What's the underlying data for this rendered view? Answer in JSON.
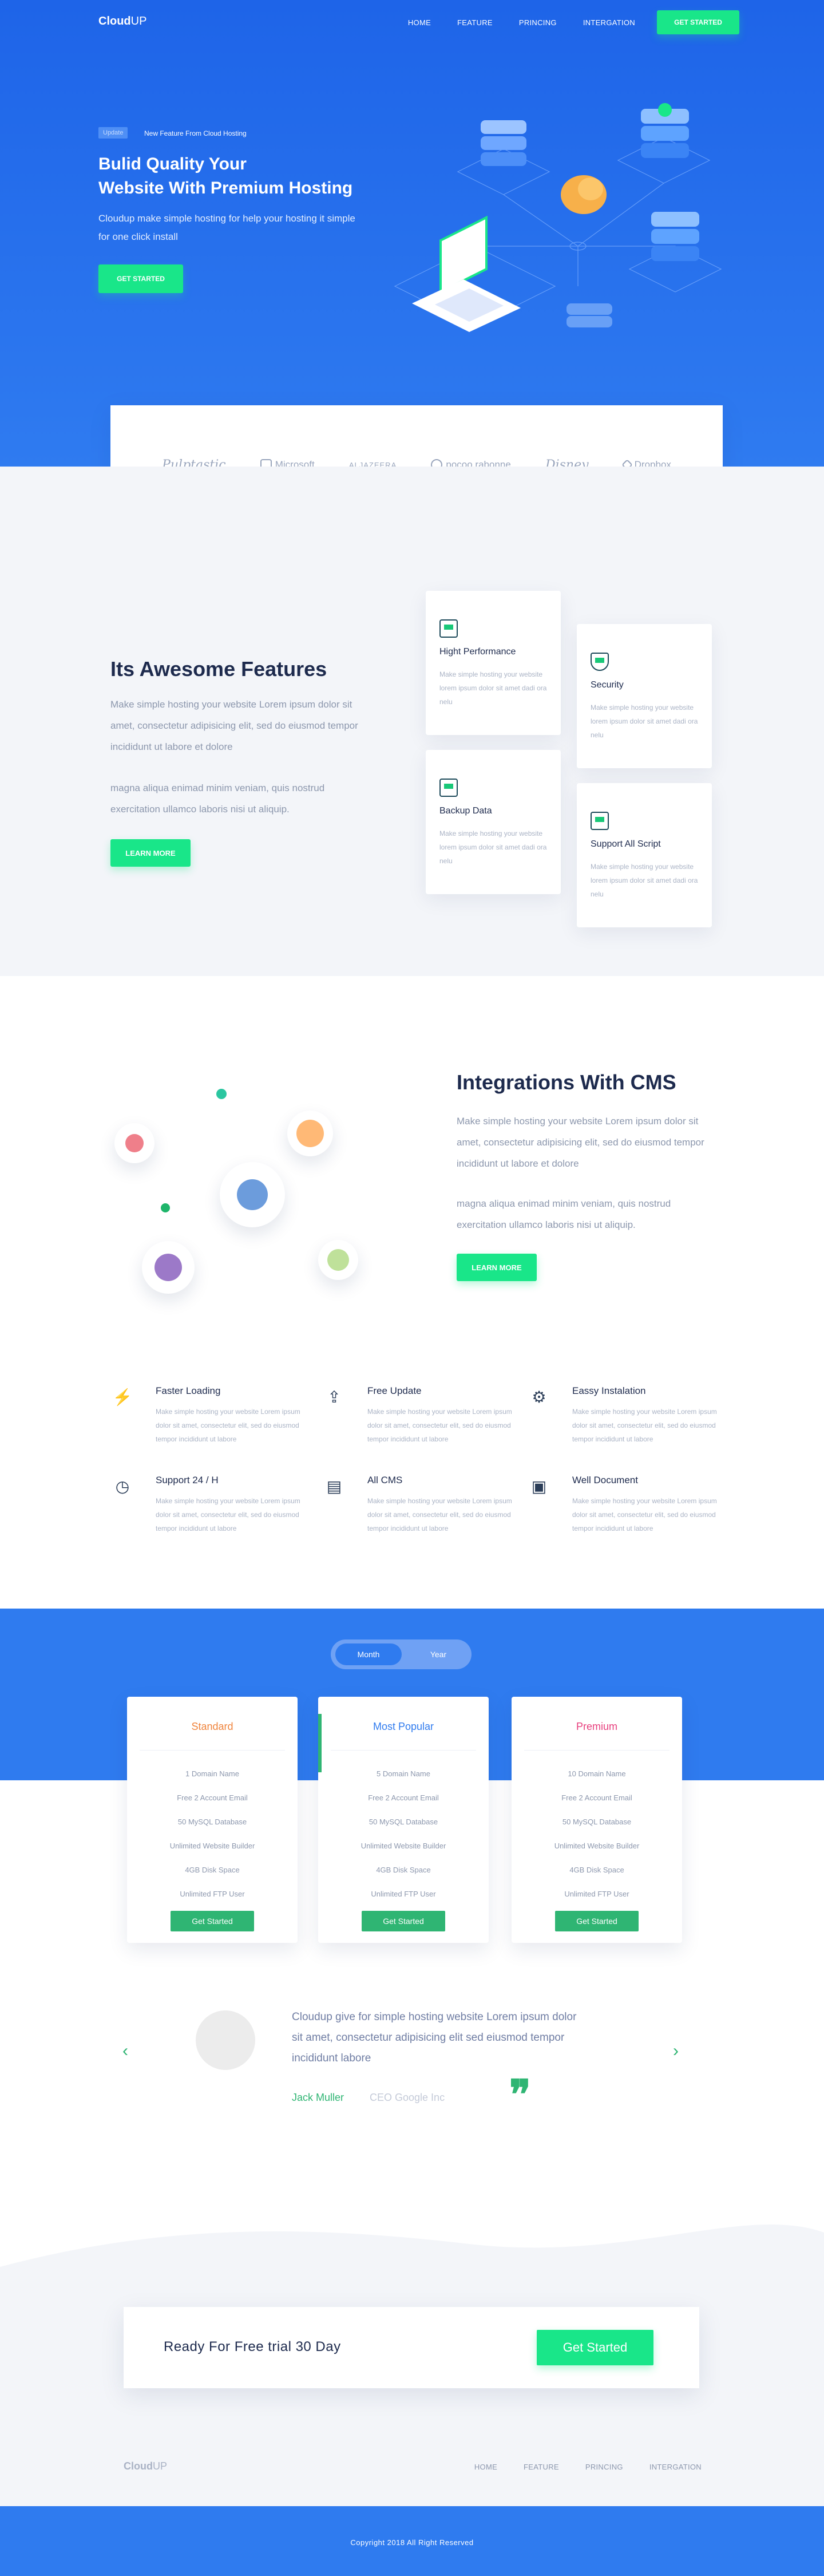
{
  "header": {
    "logo_main": "Cloud",
    "logo_accent": "UP",
    "nav": [
      "HOME",
      "FEATURE",
      "PRINCING",
      "INTERGATION"
    ],
    "cta": "GET STARTED"
  },
  "hero": {
    "badge": "Update",
    "badge_text": "New Feature From Cloud Hosting",
    "title_line1": "Bulid Quality Your",
    "title_line2": "Website With Premium Hosting",
    "subtitle": "Cloudup make simple hosting for help your hosting it simple for one click install",
    "cta": "GET STARTED"
  },
  "brands": [
    "Pulptastic",
    "Microsoft",
    "ALJAZEERA",
    "pocoo rabonne",
    "Disney",
    "Dropbox"
  ],
  "features": {
    "title": "Its Awesome Features",
    "para1": "Make simple hosting your website Lorem ipsum dolor sit amet, consectetur adipisicing elit, sed do eiusmod tempor incididunt ut labore et dolore",
    "para2": "magna aliqua enimad minim veniam, quis nostrud exercitation ullamco laboris nisi ut aliquip.",
    "cta": "LEARN MORE",
    "cards": [
      {
        "icon": "performance-icon",
        "title": "Hight Performance",
        "text": "Make simple hosting your website lorem ipsum dolor sit amet dadi ora nelu"
      },
      {
        "icon": "security-icon",
        "title": "Security",
        "text": "Make simple hosting your website lorem ipsum dolor sit amet dadi ora nelu"
      },
      {
        "icon": "backup-icon",
        "title": "Backup Data",
        "text": "Make simple hosting your website lorem ipsum dolor sit amet dadi ora nelu"
      },
      {
        "icon": "script-icon",
        "title": "Support All Script",
        "text": "Make simple hosting your website lorem ipsum dolor sit amet dadi ora nelu"
      }
    ]
  },
  "integrations": {
    "title": "Integrations With CMS",
    "para1": "Make simple hosting your website Lorem ipsum dolor sit amet, consectetur adipisicing elit, sed do eiusmod tempor incididunt ut labore et dolore",
    "para2": "magna aliqua enimad minim veniam, quis nostrud exercitation ullamco laboris nisi ut aliquip.",
    "cta": "LEARN MORE"
  },
  "services": [
    {
      "icon": "lightning-icon",
      "glyph": "⚡",
      "title": "Faster Loading",
      "text": "Make simple hosting your website Lorem ipsum dolor sit amet, consectetur elit, sed do eiusmod tempor incididunt ut labore"
    },
    {
      "icon": "update-icon",
      "glyph": "⇪",
      "title": "Free Update",
      "text": "Make simple hosting your website Lorem ipsum dolor sit amet, consectetur elit, sed do eiusmod tempor incididunt ut labore"
    },
    {
      "icon": "settings-icon",
      "glyph": "⚙",
      "title": "Eassy Instalation",
      "text": "Make simple hosting your website Lorem ipsum dolor sit amet, consectetur elit, sed do eiusmod tempor incididunt ut labore"
    },
    {
      "icon": "clock-icon",
      "glyph": "◷",
      "title": "Support 24 / H",
      "text": "Make simple hosting your website Lorem ipsum dolor sit amet, consectetur elit, sed do eiusmod tempor incididunt ut labore"
    },
    {
      "icon": "cms-icon",
      "glyph": "▤",
      "title": "All CMS",
      "text": "Make simple hosting your website Lorem ipsum dolor sit amet, consectetur elit, sed do eiusmod tempor incididunt ut labore"
    },
    {
      "icon": "document-icon",
      "glyph": "▣",
      "title": "Well Document",
      "text": "Make simple hosting your website Lorem ipsum dolor sit amet, consectetur elit, sed do eiusmod tempor incididunt ut labore"
    }
  ],
  "pricing": {
    "toggle_on": "Month",
    "toggle_off": "Year",
    "plans": [
      {
        "name": "Standard",
        "color": "#f0843c",
        "items": [
          "1 Domain Name",
          "Free 2 Account Email",
          "50 MySQL Database",
          "Unlimited Website Builder",
          "4GB Disk Space",
          "Unlimited FTP User"
        ],
        "cta": "Get Started"
      },
      {
        "name": "Most Popular",
        "color": "#2f7bef",
        "items": [
          "5 Domain Name",
          "Free 2 Account Email",
          "50 MySQL Database",
          "Unlimited Website Builder",
          "4GB Disk Space",
          "Unlimited FTP User"
        ],
        "cta": "Get Started"
      },
      {
        "name": "Premium",
        "color": "#e83e7d",
        "items": [
          "10 Domain Name",
          "Free 2 Account Email",
          "50 MySQL Database",
          "Unlimited Website Builder",
          "4GB Disk Space",
          "Unlimited FTP User"
        ],
        "cta": "Get Started"
      }
    ]
  },
  "testimonial": {
    "quote": "Cloudup give for simple hosting website Lorem ipsum dolor sit amet, consectetur adipisicing elit sed eiusmod tempor incididunt labore",
    "author": "Jack Muller",
    "role": "CEO Google Inc",
    "quote_mark": "❞",
    "prev": "‹",
    "next": "›"
  },
  "cta": {
    "title": "Ready For Free trial 30 Day",
    "button": "Get Started"
  },
  "footer": {
    "logo_main": "Cloud",
    "logo_accent": "UP",
    "nav": [
      "HOME",
      "FEATURE",
      "PRINCING",
      "INTERGATION"
    ],
    "copyright": "Copyright 2018 All Right Reserved"
  },
  "colors": {
    "primary": "#2f7bef",
    "accent": "#19e689",
    "green": "#2fb573",
    "dark": "#1d2a4d"
  }
}
